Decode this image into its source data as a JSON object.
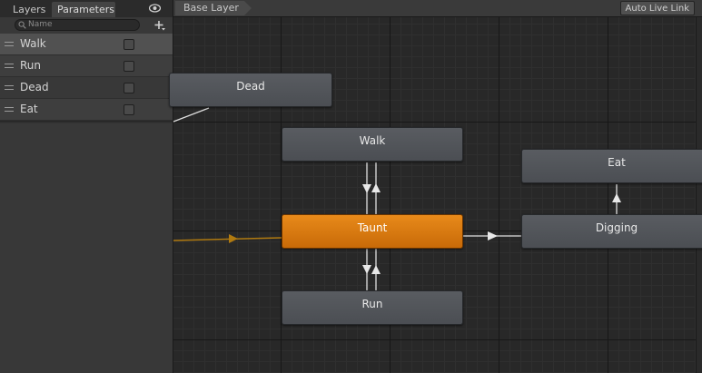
{
  "tabs": {
    "layers": "Layers",
    "parameters": "Parameters"
  },
  "search": {
    "placeholder": "Name"
  },
  "parameters": [
    {
      "name": "Walk",
      "value": false
    },
    {
      "name": "Run",
      "value": false
    },
    {
      "name": "Dead",
      "value": false
    },
    {
      "name": "Eat",
      "value": false
    }
  ],
  "graph": {
    "breadcrumb": "Base Layer",
    "live_link": "Auto Live Link",
    "states": {
      "dead": "Dead",
      "walk": "Walk",
      "eat": "Eat",
      "taunt": "Taunt",
      "digging": "Digging",
      "run": "Run"
    }
  },
  "colors": {
    "default_state": "#e08010",
    "state": "#54575c",
    "entry_transition": "#b07a10",
    "transition": "#e0e0e0"
  }
}
